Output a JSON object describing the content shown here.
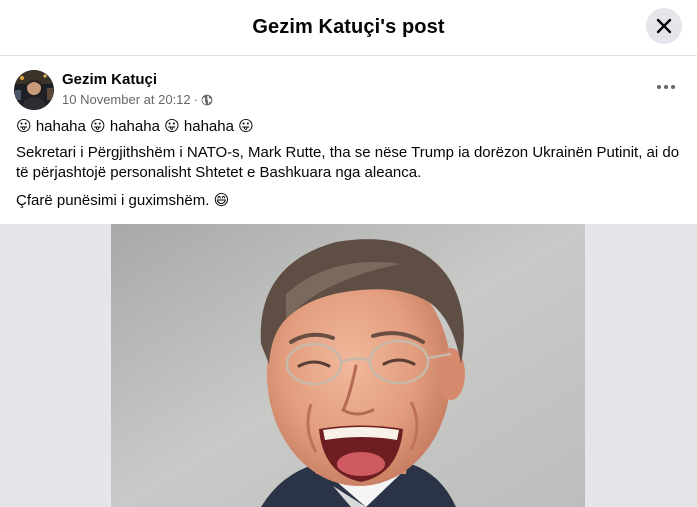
{
  "dialog": {
    "title": "Gezim Katuçi's post",
    "close_icon": "close-icon"
  },
  "post": {
    "author": "Gezim Katuçi",
    "timestamp": "10 November at 20:12",
    "separator": "·",
    "audience_icon": "globe-icon",
    "more_icon": "more-options-icon",
    "emoji_line": {
      "emoji": "😛",
      "words": [
        "hahaha",
        "hahaha",
        "hahaha"
      ]
    },
    "body": "Sekretari i Përgjithshëm i NATO-s, Mark Rutte, tha se nëse Trump ia dorëzon Ukrainën Putinit, ai do të përjashtojë personalisht Shtetet e Bashkuara nga aleanca.",
    "closing": "Çfarë punësimi i guximshëm.",
    "closing_emoji": "😄",
    "photo_subject": "laughing man with glasses"
  },
  "colors": {
    "text_primary": "#050505",
    "text_secondary": "#65676b",
    "close_bg": "#e4e6eb",
    "divider": "#dddfe2",
    "media_bg": "#e4e6e9"
  }
}
